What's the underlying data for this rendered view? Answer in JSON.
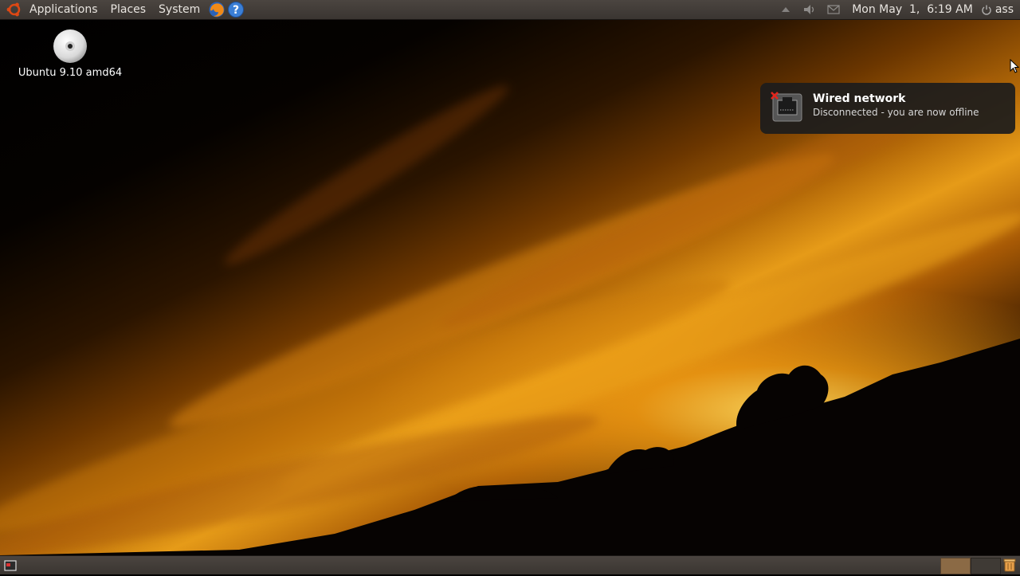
{
  "top_panel": {
    "menus": [
      "Applications",
      "Places",
      "System"
    ],
    "launchers": [
      "firefox-icon",
      "help-icon"
    ],
    "tray_icons": [
      "network-icon",
      "volume-icon",
      "mail-icon"
    ],
    "clock": "Mon May  1,  6:19 AM",
    "user": "ass"
  },
  "desktop": {
    "icon_label": "Ubuntu 9.10 amd64"
  },
  "notification": {
    "title": "Wired network",
    "body": "Disconnected - you are now offline"
  },
  "colors": {
    "panel": "#3f3a36",
    "accent": "#dd4814",
    "workspace_active": "#8b6a45"
  }
}
